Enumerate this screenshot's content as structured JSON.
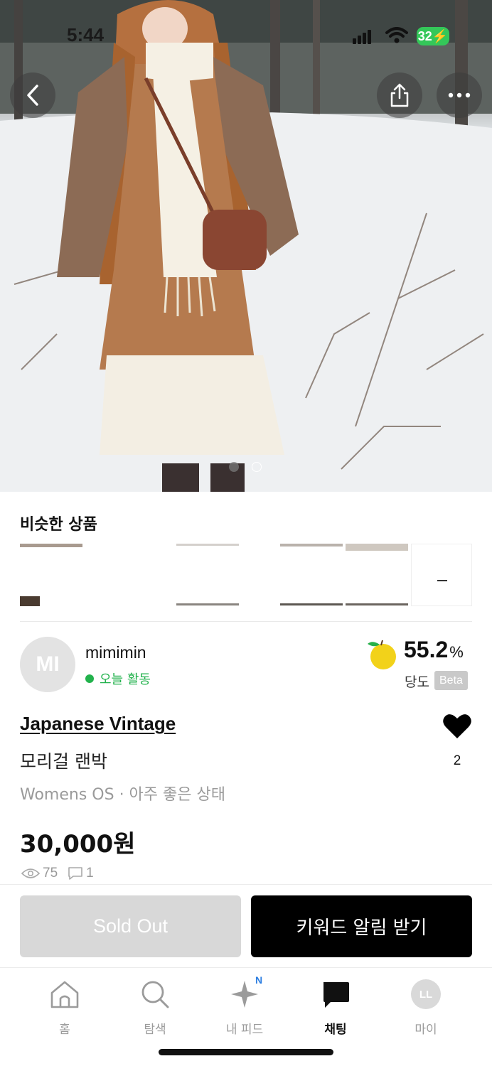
{
  "status_bar": {
    "time": "5:44",
    "battery": "32"
  },
  "hero": {
    "image_count": 2,
    "active_index": 0,
    "icons": {
      "back": "chevron-left-icon",
      "share": "share-icon",
      "more": "more-horizontal-icon"
    }
  },
  "similar": {
    "title": "비슷한 상품"
  },
  "seller": {
    "avatar_initials": "MI",
    "name": "mimimin",
    "activity": "오늘 활동",
    "activity_color": "#22b24c",
    "sweetness_value": "55.2",
    "sweetness_unit": "%",
    "sweetness_label": "당도",
    "beta_label": "Beta"
  },
  "product": {
    "brand": "Japanese Vintage",
    "name": "모리걸 랜박",
    "meta": "Womens OS · 아주 좋은 상태",
    "price": "30,000원",
    "likes": "2",
    "views": "75",
    "comments": "1"
  },
  "actions": {
    "sold_out_label": "Sold Out",
    "keyword_alert_label": "키워드 알림 받기"
  },
  "tabbar": {
    "items": [
      {
        "label": "홈",
        "icon": "home-icon"
      },
      {
        "label": "탐색",
        "icon": "search-icon"
      },
      {
        "label": "내 피드",
        "icon": "sparkle-icon",
        "badge": "N"
      },
      {
        "label": "채팅",
        "icon": "chat-icon",
        "active": true
      },
      {
        "label": "마이",
        "icon": "avatar-icon",
        "avatar_initials": "LL"
      }
    ]
  },
  "colors": {
    "accent": "#000000",
    "green": "#22b24c",
    "badge_blue": "#2a7de1",
    "disabled": "#d8d8d8"
  }
}
